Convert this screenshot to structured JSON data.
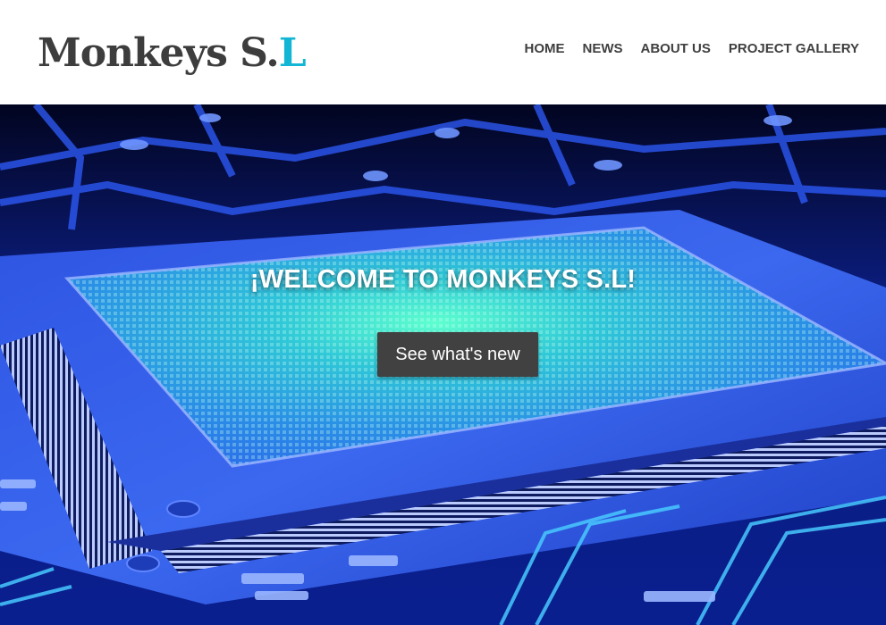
{
  "brand": {
    "name_main": "Monkeys S.",
    "name_accent": "L",
    "accent_color": "#12b5d3",
    "text_color": "#3d3d3d"
  },
  "nav": {
    "items": [
      {
        "label": "HOME"
      },
      {
        "label": "NEWS"
      },
      {
        "label": "ABOUT US"
      },
      {
        "label": "PROJECT GALLERY"
      }
    ]
  },
  "hero": {
    "title": "¡WELCOME TO MONKEYS S.L!",
    "button_label": "See what's new",
    "button_color": "#414141",
    "image": "circuit-board-chip-image"
  }
}
